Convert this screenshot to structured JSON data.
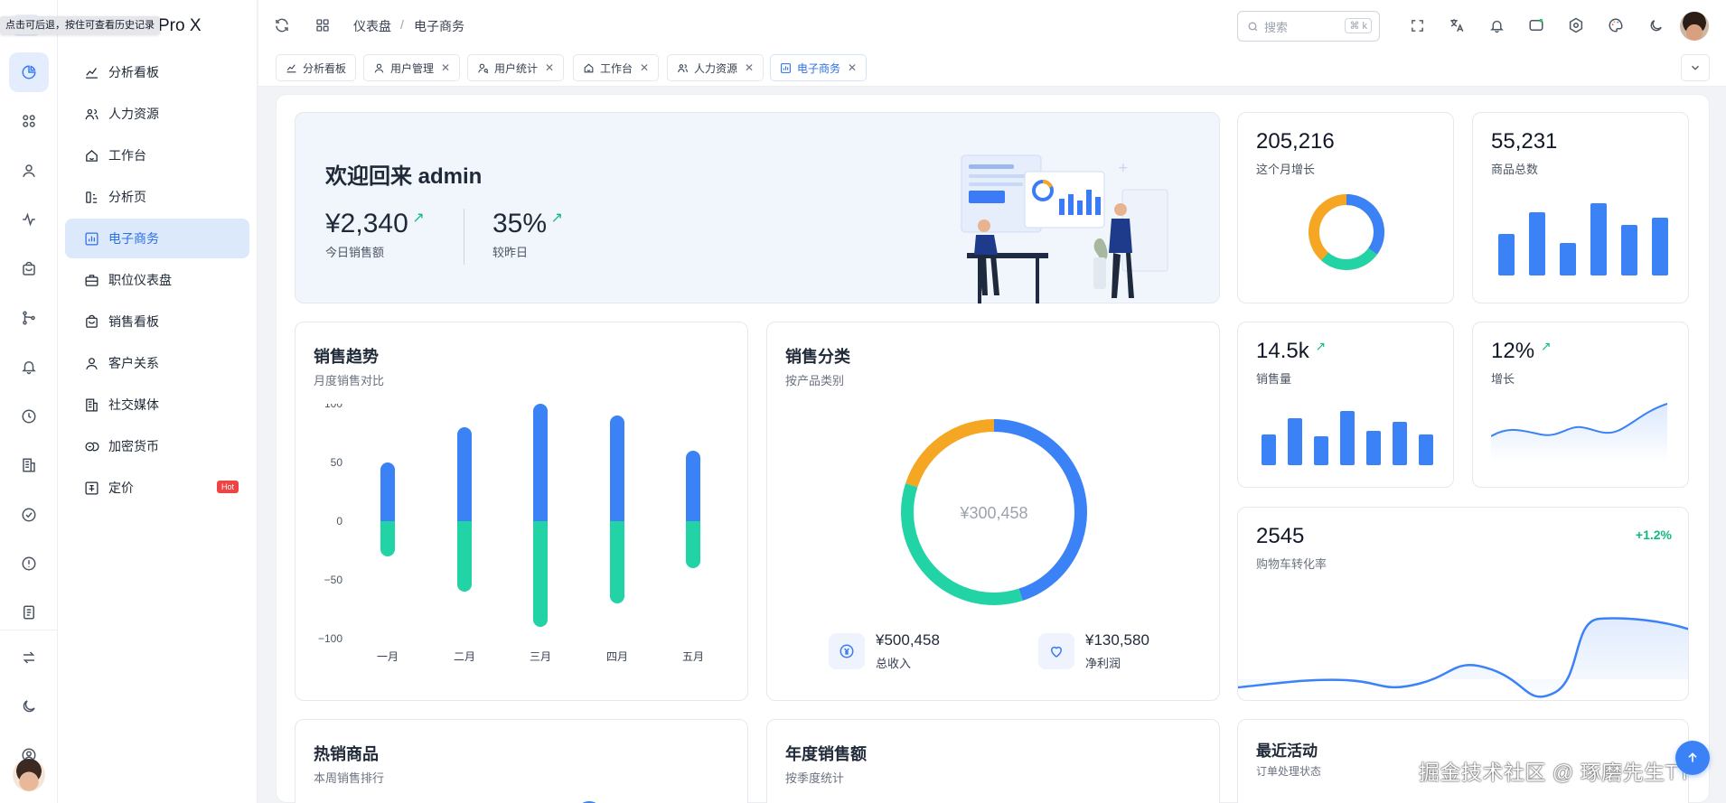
{
  "tooltip": "点击可后退，按住可查看历史记录",
  "brand": "Pro X",
  "rail": {
    "items": [
      "pie-chart-icon",
      "apps-icon",
      "user-icon",
      "pulse-icon",
      "bag-icon",
      "git-branch-icon",
      "bell-icon",
      "clock-icon",
      "building-icon",
      "check-circle-icon",
      "alert-circle-icon",
      "file-icon"
    ],
    "bottom": [
      "swap-icon",
      "moon-icon",
      "user-circle-icon"
    ]
  },
  "menu": [
    {
      "label": "分析看板",
      "icon": "line-chart-icon"
    },
    {
      "label": "人力资源",
      "icon": "users-icon"
    },
    {
      "label": "工作台",
      "icon": "home-icon"
    },
    {
      "label": "分析页",
      "icon": "bar-icon"
    },
    {
      "label": "电子商务",
      "icon": "shop-chart-icon",
      "active": true
    },
    {
      "label": "职位仪表盘",
      "icon": "briefcase-icon"
    },
    {
      "label": "销售看板",
      "icon": "bag-icon"
    },
    {
      "label": "客户关系",
      "icon": "user-icon"
    },
    {
      "label": "社交媒体",
      "icon": "building-icon"
    },
    {
      "label": "加密货币",
      "icon": "coins-icon"
    },
    {
      "label": "定价",
      "icon": "price-icon",
      "badge": "Hot"
    }
  ],
  "breadcrumb": {
    "root": "仪表盘",
    "separator": "/",
    "current": "电子商务"
  },
  "search": {
    "placeholder": "搜索",
    "shortcut": "⌘ k"
  },
  "tabs": [
    {
      "label": "分析看板",
      "closable": false
    },
    {
      "label": "用户管理",
      "closable": true
    },
    {
      "label": "用户统计",
      "closable": true
    },
    {
      "label": "工作台",
      "closable": true
    },
    {
      "label": "人力资源",
      "closable": true
    },
    {
      "label": "电子商务",
      "closable": true,
      "active": true
    }
  ],
  "welcome": {
    "title": "欢迎回来 admin",
    "sales": {
      "value": "¥2,340",
      "label": "今日销售额"
    },
    "compare": {
      "value": "35%",
      "label": "较昨日"
    }
  },
  "stats": {
    "month_growth": {
      "value": "205,216",
      "label": "这个月增长"
    },
    "products": {
      "value": "55,231",
      "label": "商品总数"
    },
    "sales_volume": {
      "value": "14.5k",
      "label": "销售量"
    },
    "growth": {
      "value": "12%",
      "label": "增长"
    },
    "cart": {
      "value": "2545",
      "label": "购物车转化率",
      "delta": "+1.2%"
    }
  },
  "sales_trend": {
    "title": "销售趋势",
    "subtitle": "月度销售对比"
  },
  "sales_category": {
    "title": "销售分类",
    "subtitle": "按产品类别",
    "center": "¥300,458",
    "revenue": {
      "value": "¥500,458",
      "label": "总收入"
    },
    "profit": {
      "value": "¥130,580",
      "label": "净利润"
    }
  },
  "bottom_cards": {
    "hot": {
      "title": "热销商品",
      "subtitle": "本周销售排行"
    },
    "annual": {
      "title": "年度销售额",
      "subtitle": "按季度统计"
    },
    "activity": {
      "title": "最近活动",
      "subtitle": "订单处理状态"
    }
  },
  "watermark": "掘金技术社区 @ 琢磨先生TT",
  "colors": {
    "primary": "#3b82f6",
    "teal": "#22d3a6",
    "orange": "#f5a623",
    "up": "#10b981"
  },
  "chart_data": [
    {
      "type": "bar",
      "categories": [
        "一月",
        "二月",
        "三月",
        "四月",
        "五月"
      ],
      "series": [
        {
          "values": [
            50,
            80,
            100,
            90,
            60
          ]
        },
        {
          "values": [
            -30,
            -60,
            -90,
            -70,
            -40
          ]
        }
      ],
      "ylim": [
        -100,
        100
      ],
      "yticks": [
        100,
        50,
        0,
        -50,
        -100
      ]
    },
    {
      "type": "pie",
      "values": [
        45,
        35,
        20
      ],
      "colors": [
        "#3b82f6",
        "#22d3a6",
        "#f5a623"
      ]
    }
  ]
}
